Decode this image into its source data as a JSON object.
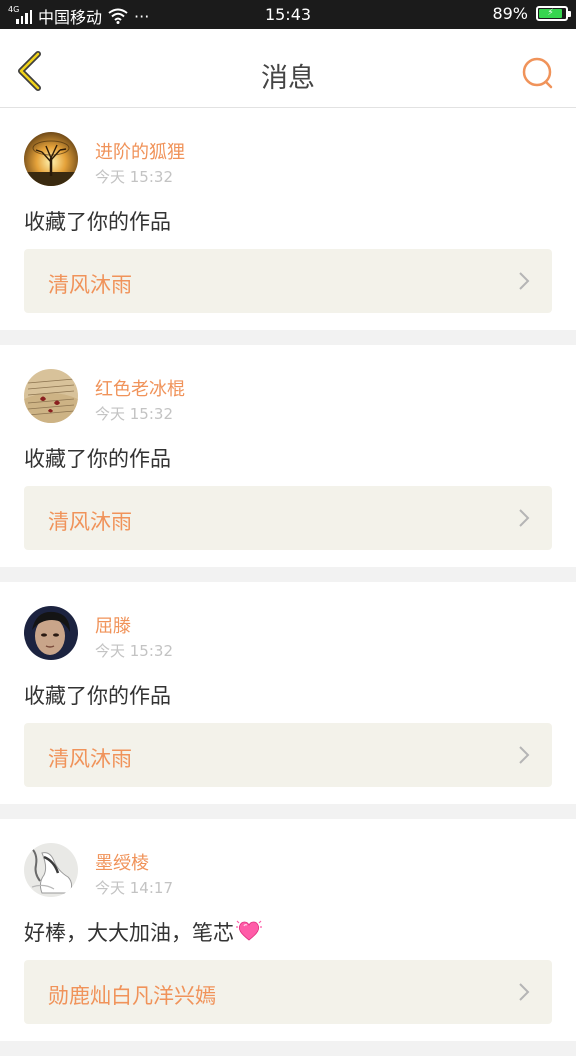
{
  "status_bar": {
    "network_tag": "4G",
    "carrier": "中国移动",
    "more": "···",
    "time": "15:43",
    "battery_percent": "89%",
    "battery_level": 0.89
  },
  "header": {
    "back_icon": "chevron-left-icon",
    "title": "消息",
    "search_icon": "search-icon",
    "accent_color": "#f0935a"
  },
  "messages": [
    {
      "avatar": "tree-sunset-avatar",
      "username": "进阶的狐狸",
      "time": "今天 15:32",
      "text": "收藏了你的作品",
      "work_title": "清风沐雨"
    },
    {
      "avatar": "book-page-avatar",
      "username": "红色老冰棍",
      "time": "今天 15:32",
      "text": "收藏了你的作品",
      "work_title": "清风沐雨"
    },
    {
      "avatar": "portrait-avatar",
      "username": "屈滕",
      "time": "今天 15:32",
      "text": "收藏了你的作品",
      "work_title": "清风沐雨"
    },
    {
      "avatar": "ink-figure-avatar",
      "username": "墨绶棱",
      "time": "今天 14:17",
      "text": "好棒，大大加油，笔芯",
      "text_emoji": "sparkling-heart-icon",
      "work_title": "勋鹿灿白凡洋兴嫣"
    }
  ]
}
